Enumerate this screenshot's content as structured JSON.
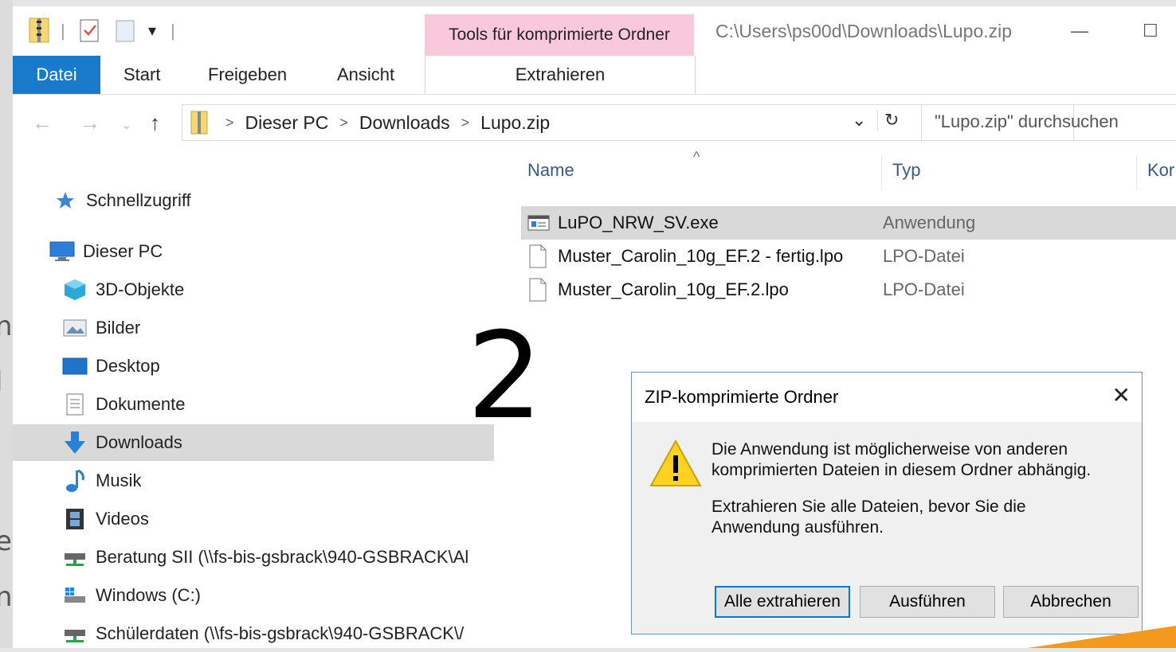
{
  "window": {
    "title": "C:\\Users\\ps00d\\Downloads\\Lupo.zip",
    "context_header": "Tools für komprimierte Ordner"
  },
  "ribbon": {
    "tabs": [
      "Datei",
      "Start",
      "Freigeben",
      "Ansicht"
    ],
    "context_tab": "Extrahieren"
  },
  "address": {
    "crumbs": [
      "Dieser PC",
      "Downloads",
      "Lupo.zip"
    ],
    "search_placeholder": "\"Lupo.zip\" durchsuchen"
  },
  "nav": {
    "quick_access": "Schnellzugriff",
    "this_pc": "Dieser PC",
    "items": [
      "3D-Objekte",
      "Bilder",
      "Desktop",
      "Dokumente",
      "Downloads",
      "Musik",
      "Videos",
      "Beratung SII (\\\\fs-bis-gsbrack\\940-GSBRACK\\Al",
      "Windows (C:)",
      "Schülerdaten (\\\\fs-bis-gsbrack\\940-GSBRACK\\/"
    ],
    "selected": "Downloads"
  },
  "columns": {
    "name": "Name",
    "type": "Typ",
    "more": "Kor"
  },
  "files": [
    {
      "name": "LuPO_NRW_SV.exe",
      "type": "Anwendung"
    },
    {
      "name": "Muster_Carolin_10g_EF.2 - fertig.lpo",
      "type": "LPO-Datei"
    },
    {
      "name": "Muster_Carolin_10g_EF.2.lpo",
      "type": "LPO-Datei"
    }
  ],
  "annotation": "2",
  "dialog": {
    "title": "ZIP-komprimierte Ordner",
    "message1": "Die Anwendung ist möglicherweise von anderen komprimierten Dateien in diesem Ordner abhängig.",
    "message2": "Extrahieren Sie alle Dateien, bevor Sie die Anwendung ausführen.",
    "buttons": {
      "extract_all": "Alle extrahieren",
      "run": "Ausführen",
      "cancel": "Abbrechen"
    }
  },
  "colors": {
    "file_tab": "#1979ca",
    "context_tab": "#f9c8da",
    "selection": "#d9d9d9",
    "dialog_border": "#6b8fc4"
  }
}
